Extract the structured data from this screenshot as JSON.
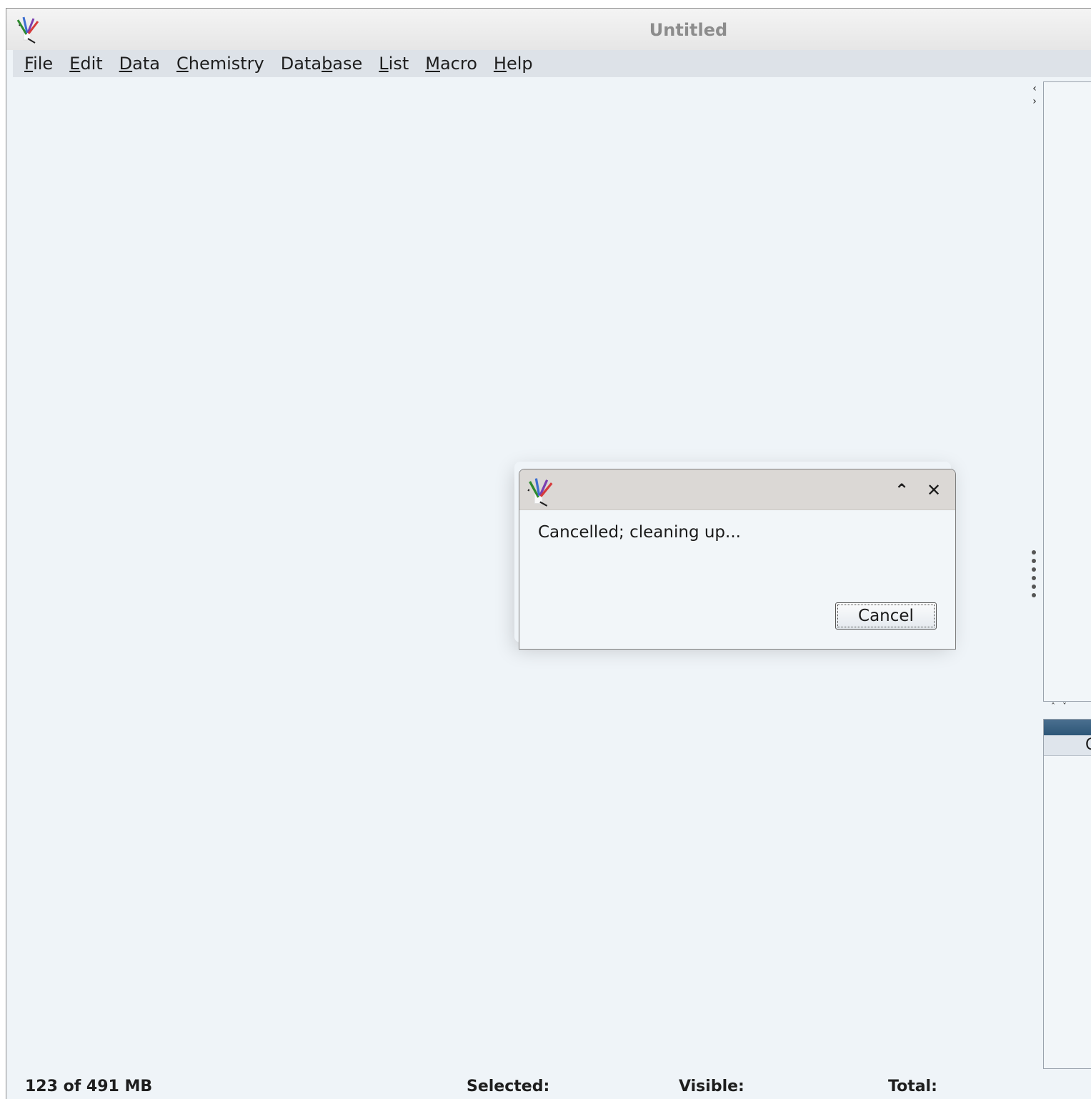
{
  "window": {
    "title": "Untitled"
  },
  "menubar": {
    "items": [
      {
        "mnemonic": "F",
        "rest": "ile"
      },
      {
        "mnemonic": "E",
        "rest": "dit"
      },
      {
        "mnemonic": "D",
        "rest": "ata"
      },
      {
        "mnemonic": "C",
        "rest": "hemistry"
      },
      {
        "pre": "Data",
        "mnemonic": "b",
        "rest": "ase"
      },
      {
        "mnemonic": "L",
        "rest": "ist"
      },
      {
        "mnemonic": "M",
        "rest": "acro"
      },
      {
        "mnemonic": "H",
        "rest": "elp"
      }
    ]
  },
  "right_panel": {
    "subheader_text": "C"
  },
  "dialog": {
    "message": "Cancelled; cleaning up...",
    "cancel_label": "Cancel",
    "minimize_glyph": "⌃",
    "close_glyph": "✕"
  },
  "statusbar": {
    "memory": "123 of 491 MB",
    "selected_label": "Selected:",
    "visible_label": "Visible:",
    "total_label": "Total:"
  },
  "icons": {
    "app": "datawarrior-feather-icon",
    "splitter": "expand-collapse-arrows-icon",
    "grip": "drag-grip-icon"
  },
  "colors": {
    "workspace": "#eff4f8",
    "menubar": "#dde2e8",
    "dialog_titlebar": "#dbd8d5",
    "panel_header": "#2d5677"
  }
}
